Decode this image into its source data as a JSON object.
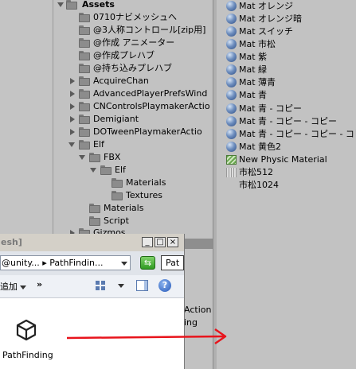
{
  "project_tree": {
    "root": "Assets",
    "items": [
      {
        "label": "0710ナビメッシュへ"
      },
      {
        "label": "@3人称コントロール[zip用]"
      },
      {
        "label": "@作成 アニメーター"
      },
      {
        "label": "@作成プレハブ"
      },
      {
        "label": "@持ち込みプレハブ"
      },
      {
        "label": "AcquireChan"
      },
      {
        "label": "AdvancedPlayerPrefsWind"
      },
      {
        "label": "CNControlsPlaymakerActio"
      },
      {
        "label": "Demigiant"
      },
      {
        "label": "DOTweenPlaymakerActio"
      },
      {
        "label": "Elf"
      },
      {
        "label": "FBX"
      },
      {
        "label": "Elf"
      },
      {
        "label": "Materials"
      },
      {
        "label": "Textures"
      },
      {
        "label": "Materials"
      },
      {
        "label": "Script"
      },
      {
        "label": "Gizmos"
      }
    ]
  },
  "asset_list": [
    {
      "label": "Mat オレンジ",
      "icon": "material-sphere-icon"
    },
    {
      "label": "Mat オレンジ暗",
      "icon": "material-sphere-icon"
    },
    {
      "label": "Mat スイッチ",
      "icon": "material-sphere-icon"
    },
    {
      "label": "Mat 市松",
      "icon": "material-sphere-icon"
    },
    {
      "label": "Mat 紫",
      "icon": "material-sphere-icon"
    },
    {
      "label": "Mat 緑",
      "icon": "material-sphere-icon"
    },
    {
      "label": "Mat 薄青",
      "icon": "material-sphere-icon"
    },
    {
      "label": "Mat 青",
      "icon": "material-sphere-icon"
    },
    {
      "label": "Mat 青 - コピー",
      "icon": "material-sphere-icon"
    },
    {
      "label": "Mat 青 - コピー - コピー",
      "icon": "material-sphere-icon"
    },
    {
      "label": "Mat 青 - コピー - コピー - コピー",
      "icon": "material-sphere-icon"
    },
    {
      "label": "Mat 黄色2",
      "icon": "material-sphere-icon"
    },
    {
      "label": "New Physic Material",
      "icon": "physic-material-icon"
    },
    {
      "label": "市松512",
      "icon": "texture-icon"
    },
    {
      "label": "市松1024",
      "icon": ""
    }
  ],
  "explorer": {
    "title": "esh]",
    "address": "@unity... ▸ PathFindin...",
    "search_placeholder": "Pat",
    "add_label": "追加",
    "more_label": "»",
    "help_label": "?",
    "file_name": "PathFinding"
  },
  "behind_text": {
    "line1": "Action",
    "line2": "ing"
  },
  "colors": {
    "background": "#c2c2c2",
    "arrow": "#e8141c",
    "material_sphere": "#4a6ea6"
  }
}
